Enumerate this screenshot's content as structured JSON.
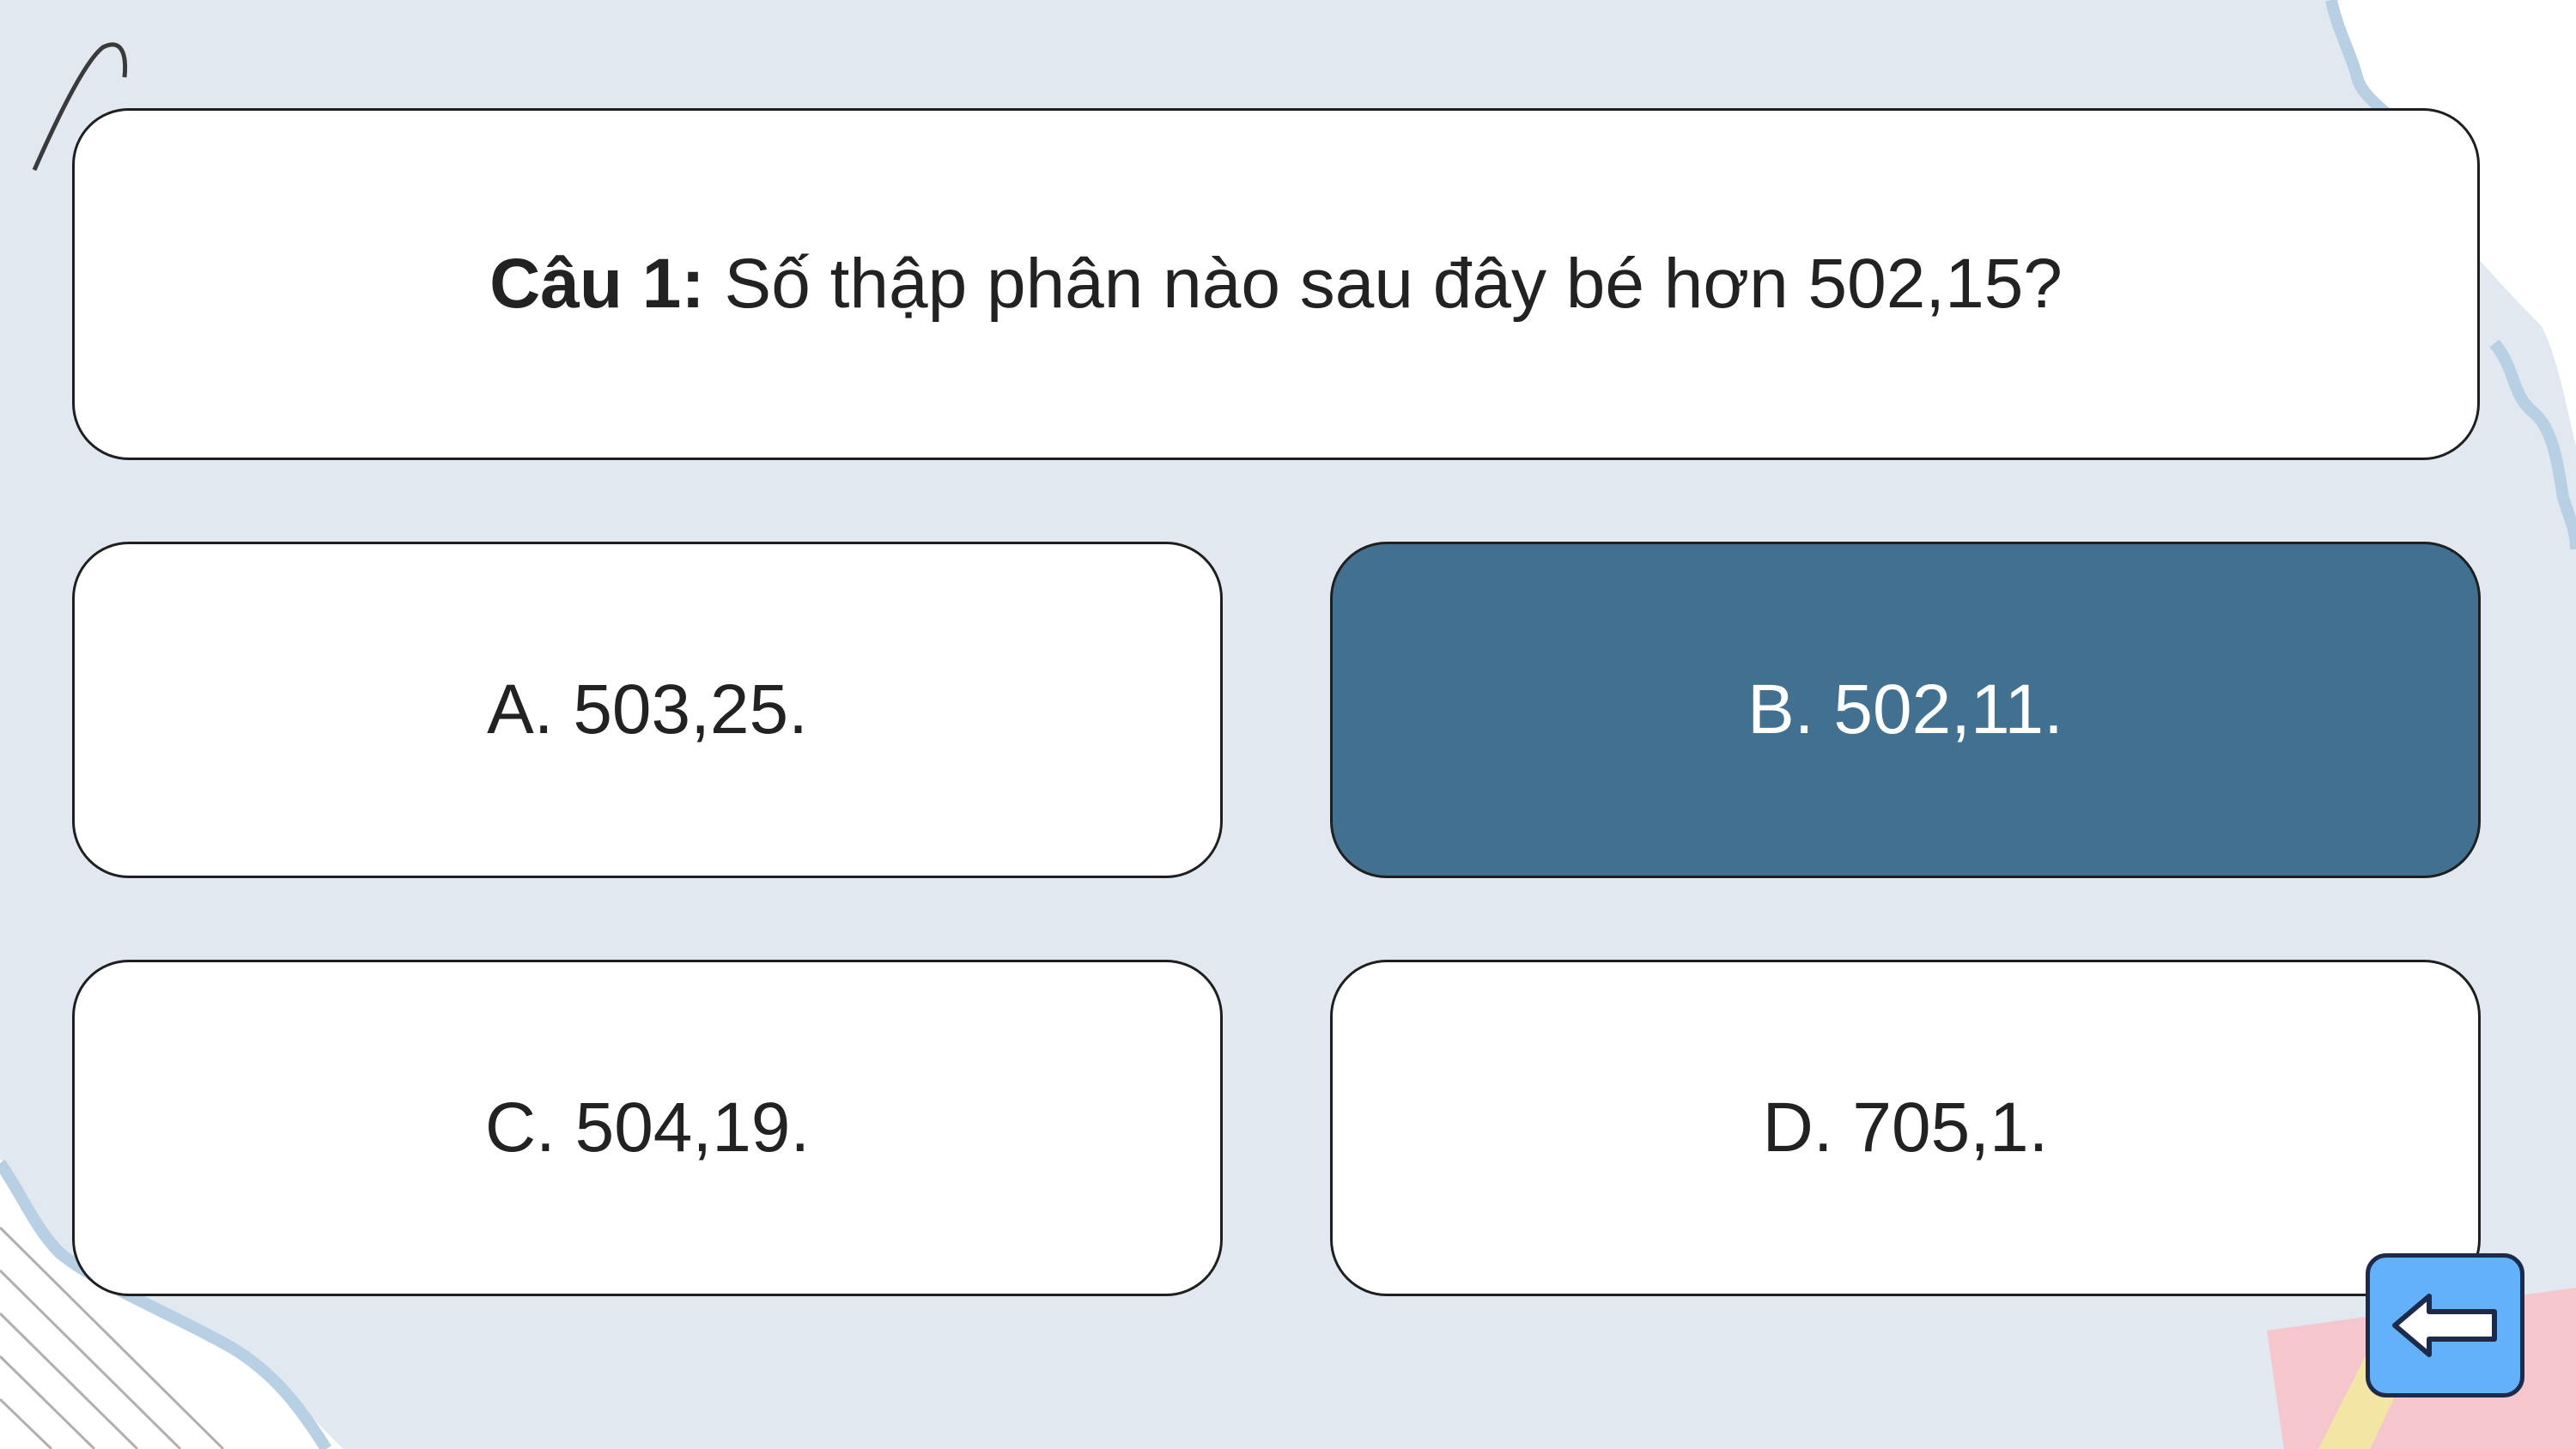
{
  "question": {
    "label": "Câu 1:",
    "text": "Số thập phân nào sau đây bé hơn 502,15?"
  },
  "answers": [
    {
      "text": "A. 503,25."
    },
    {
      "text": "B. 502,11."
    },
    {
      "text": "C. 504,19."
    },
    {
      "text": "D. 705,1."
    }
  ],
  "selected_answer": "B",
  "nav": {
    "back_icon": "arrow-left-icon"
  },
  "colors": {
    "background": "#e1e8f0",
    "selected_fill": "#417090",
    "back_button": "#63b1f8"
  }
}
